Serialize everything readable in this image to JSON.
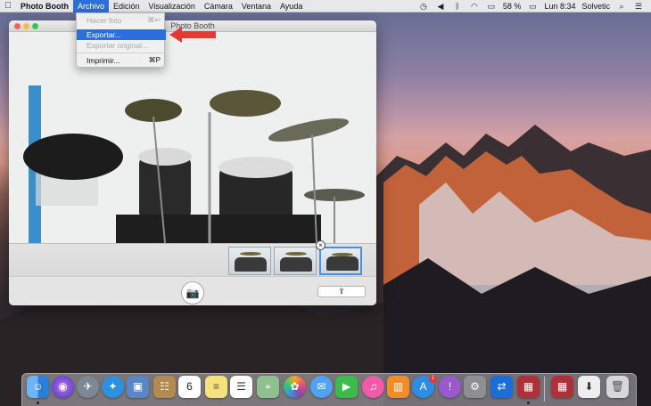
{
  "menubar": {
    "apple_icon": "apple-icon",
    "app_name": "Photo Booth",
    "menus": [
      "Archivo",
      "Edición",
      "Visualización",
      "Cámara",
      "Ventana",
      "Ayuda"
    ],
    "active_menu": "Archivo",
    "battery": "58 %",
    "clock": "Lun 8:34",
    "user": "Solvetic",
    "tray_icons": [
      "timemachine-icon",
      "volume-icon",
      "bluetooth-icon",
      "wifi-icon",
      "airplay-icon",
      "spotlight-icon",
      "list-icon"
    ]
  },
  "file_menu": {
    "items": [
      {
        "label": "Hacer foto",
        "shortcut": "⌘↩",
        "enabled": false
      },
      {
        "label": "Exportar...",
        "shortcut": "",
        "enabled": true,
        "highlighted": true
      },
      {
        "label": "Exportar original...",
        "shortcut": "",
        "enabled": false
      },
      {
        "label": "Imprimir...",
        "shortcut": "⌘P",
        "enabled": true
      }
    ]
  },
  "window": {
    "title": "Photo Booth",
    "thumbnail_count": 3,
    "selected_thumbnail": 3,
    "close_symbol": "×",
    "camera_icon": "camera-icon",
    "share_icon": "share-icon"
  },
  "annotation": {
    "color": "#e53935",
    "shape": "arrow-left"
  },
  "dock": {
    "calendar_day": "6",
    "appstore_badge": "1",
    "apps": [
      "Finder",
      "Siri",
      "Launchpad",
      "Safari",
      "Preview",
      "Contacts",
      "Calendar",
      "Notes",
      "Reminders",
      "Maps",
      "Photos",
      "Messages",
      "FaceTime",
      "iTunes",
      "iBooks",
      "App Store",
      "Feedback",
      "System Preferences",
      "TeamViewer",
      "Photo Booth",
      "Photo Booth Library",
      "Downloads",
      "Trash"
    ]
  },
  "colors": {
    "accent": "#2c6fd9",
    "menubar": "#ececee",
    "window": "#e6e6e6"
  }
}
